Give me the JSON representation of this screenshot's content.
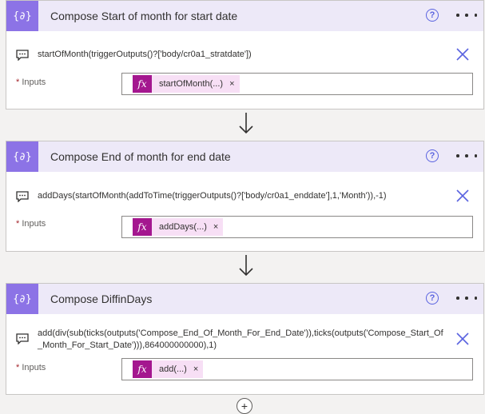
{
  "cards": [
    {
      "title": "Compose Start of month for start date",
      "expression": "startOfMonth(triggerOutputs()?['body/cr0a1_stratdate'])",
      "inputs_label": "Inputs",
      "token_label": "startOfMonth(...)"
    },
    {
      "title": "Compose End of month for end date",
      "expression": "addDays(startOfMonth(addToTime(triggerOutputs()?['body/cr0a1_enddate'],1,'Month')),-1)",
      "inputs_label": "Inputs",
      "token_label": "addDays(...)"
    },
    {
      "title": "Compose DiffinDays",
      "expression": "add(div(sub(ticks(outputs('Compose_End_Of_Month_For_End_Date')),ticks(outputs('Compose_Start_Of_Month_For_Start_Date'))),864000000000),1)",
      "inputs_label": "Inputs",
      "token_label": "add(...)"
    }
  ],
  "common": {
    "required_mark": "*",
    "help_glyph": "?",
    "fx_glyph": "fx",
    "remove_glyph": "×",
    "add_glyph": "+"
  },
  "colors": {
    "header_bg": "#ede9f8",
    "action_icon": "#8c73e6",
    "token_bg": "#f7dff5",
    "token_fx": "#a4178f",
    "accent": "#5a63e0"
  },
  "icons": [
    "compose-icon",
    "help-icon",
    "more-icon",
    "comment-icon",
    "close-icon",
    "fx-icon",
    "arrow-down-icon",
    "add-icon"
  ]
}
